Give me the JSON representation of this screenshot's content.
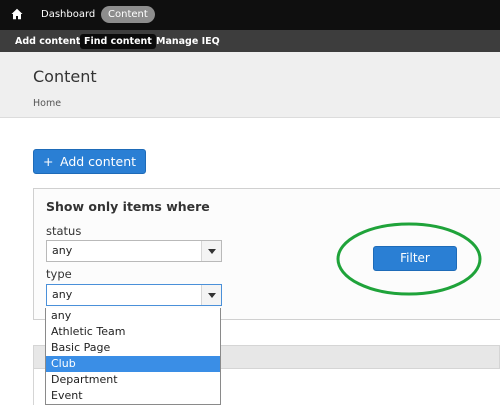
{
  "toolbar": {
    "dashboard_label": "Dashboard",
    "content_label": "Content"
  },
  "subnav": {
    "items": [
      "Add content",
      "Find content",
      "Manage IEQ"
    ],
    "active": "Find content"
  },
  "header": {
    "title": "Content",
    "breadcrumb": "Home"
  },
  "actions": {
    "add_content_label": "Add content"
  },
  "filter": {
    "heading": "Show only items where",
    "status_label": "status",
    "status_value": "any",
    "type_label": "type",
    "type_value": "any",
    "type_options": [
      "any",
      "Athletic Team",
      "Basic Page",
      "Club",
      "Department",
      "Event"
    ],
    "type_highlighted": "Club",
    "filter_button": "Filter"
  },
  "colors": {
    "accent": "#2a7fd4",
    "annotation": "#1fa33a",
    "highlight": "#3a8ee6"
  },
  "icons": [
    "home-icon",
    "plus-icon",
    "chevron-down-icon"
  ]
}
